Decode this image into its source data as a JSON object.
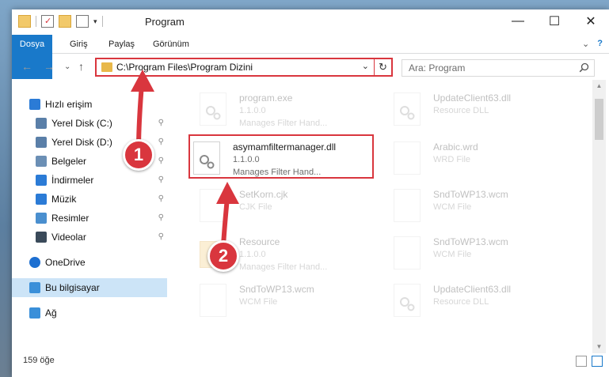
{
  "window": {
    "title": "Program",
    "controls": {
      "minimize": "—",
      "maximize": "☐",
      "close": "✕"
    }
  },
  "ribbon": {
    "tabs": [
      "Dosya",
      "Giriş",
      "Paylaş",
      "Görünüm"
    ],
    "expand_glyph": "⌄",
    "help_glyph": "?"
  },
  "address": {
    "path": "C:\\Program Files\\Program Dizini",
    "dropdown": "⌄",
    "refresh": "↻"
  },
  "nav_buttons": {
    "back": "←",
    "forward": "→",
    "recent": "⌄",
    "up": "↑"
  },
  "search": {
    "placeholder": "Ara: Program",
    "icon": "search-icon"
  },
  "sidebar": {
    "items": [
      {
        "label": "Hızlı erişim",
        "icon": "star-icon",
        "pinned": false
      },
      {
        "label": "Yerel Disk (C:)",
        "icon": "drive-icon",
        "pinned": true
      },
      {
        "label": "Yerel Disk (D:)",
        "icon": "drive-icon",
        "pinned": true
      },
      {
        "label": "Belgeler",
        "icon": "document-icon",
        "pinned": true
      },
      {
        "label": "İndirmeler",
        "icon": "download-icon",
        "pinned": true
      },
      {
        "label": "Müzik",
        "icon": "music-icon",
        "pinned": true
      },
      {
        "label": "Resimler",
        "icon": "pictures-icon",
        "pinned": true
      },
      {
        "label": "Videolar",
        "icon": "video-icon",
        "pinned": true
      },
      {
        "label": "OneDrive",
        "icon": "cloud-icon",
        "pinned": false
      },
      {
        "label": "Bu bilgisayar",
        "icon": "computer-icon",
        "pinned": false
      },
      {
        "label": "Ağ",
        "icon": "network-icon",
        "pinned": false
      }
    ],
    "pin_glyph": "📌"
  },
  "files": [
    {
      "name": "program.exe",
      "line2": "1.1.0.0",
      "line3": "Manages Filter Hand...",
      "faded": true
    },
    {
      "name": "UpdateClient63.dll",
      "line2": "Resource DLL",
      "line3": "",
      "faded": true
    },
    {
      "name": "asymamfiltermanager.dll",
      "line2": "1.1.0.0",
      "line3": "Manages Filter Hand...",
      "faded": false
    },
    {
      "name": "Arabic.wrd",
      "line2": "WRD File",
      "line3": "",
      "faded": true
    },
    {
      "name": "SetKorn.cjk",
      "line2": "CJK File",
      "line3": "",
      "faded": true
    },
    {
      "name": "SndToWP13.wcm",
      "line2": "WCM File",
      "line3": "",
      "faded": true
    },
    {
      "name": "Resource",
      "line2": "1.1.0.0",
      "line3": "Manages Filter Hand...",
      "faded": true
    },
    {
      "name": "SndToWP13.wcm",
      "line2": "WCM File",
      "line3": "",
      "faded": true
    },
    {
      "name": "SndToWP13.wcm",
      "line2": "WCM File",
      "line3": "",
      "faded": true
    },
    {
      "name": "UpdateClient63.dll",
      "line2": "Resource DLL",
      "line3": "",
      "faded": true
    }
  ],
  "status": {
    "count": "159 öğe"
  },
  "annotations": {
    "step1": "1",
    "step2": "2",
    "color": "#d9363e"
  }
}
